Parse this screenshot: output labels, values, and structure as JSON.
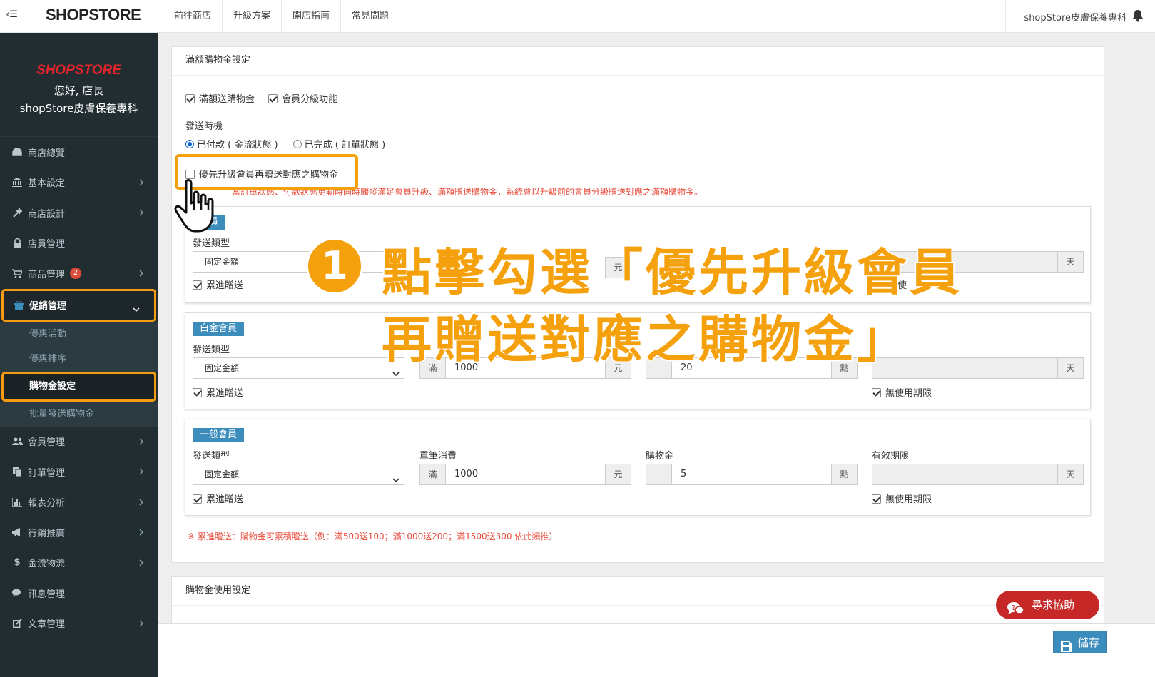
{
  "topbar": {
    "logo": "SHOPSTORE",
    "nav": [
      "前往商店",
      "升級方案",
      "開店指南",
      "常見問題"
    ],
    "shop_name": "shopStore皮膚保養專科"
  },
  "sidebar": {
    "logo": "SHOPSTORE",
    "greeting": "您好, 店長",
    "shop_name": "shopStore皮膚保養專科",
    "items": [
      {
        "label": "商店總覽",
        "icon": "dashboard-icon"
      },
      {
        "label": "基本設定",
        "icon": "bank-icon"
      },
      {
        "label": "商店設計",
        "icon": "magic-wand-icon"
      },
      {
        "label": "店員管理",
        "icon": "lock-icon"
      },
      {
        "label": "商品管理",
        "icon": "cart-icon",
        "badge": "2"
      },
      {
        "label": "促銷管理",
        "icon": "gift-icon"
      },
      {
        "label": "會員管理",
        "icon": "users-icon"
      },
      {
        "label": "訂單管理",
        "icon": "copy-icon"
      },
      {
        "label": "報表分析",
        "icon": "bar-chart-icon"
      },
      {
        "label": "行銷推廣",
        "icon": "bullhorn-icon"
      },
      {
        "label": "金流物流",
        "icon": "dollar-icon"
      },
      {
        "label": "訊息管理",
        "icon": "comments-icon"
      },
      {
        "label": "文章管理",
        "icon": "edit-icon"
      }
    ],
    "sub_items": [
      "優惠活動",
      "優惠排序",
      "購物金設定",
      "批量發送購物金"
    ]
  },
  "panel1": {
    "title": "滿額購物金設定",
    "check_full": "滿額送購物金",
    "check_level": "會員分級功能",
    "send_timing_label": "發送時機",
    "radio_paid": "已付款 ( 金流狀態 )",
    "radio_done": "已完成 ( 訂單狀態 )",
    "priority_check": "優先升級會員再贈送對應之購物金",
    "warning": "當訂單狀態、付款狀態更動時同時觸發滿足會員升級、滿額贈送購物金，系統會以升級前的會員分級贈送對應之滿額購物金。",
    "tiers": [
      {
        "name": "會員",
        "type": "固定金額",
        "unit_yuan": "元",
        "unit_day": "天",
        "accumulate": "累進贈送",
        "partial_expiry": "使"
      },
      {
        "name": "白金會員",
        "type": "固定金額",
        "prefix": "滿",
        "amount": "1000",
        "unit_yuan": "元",
        "points": "20",
        "unit_pt": "點",
        "unit_day": "天",
        "accumulate": "累進贈送",
        "no_expiry": "無使用期限"
      },
      {
        "name": "一般會員",
        "type": "固定金額",
        "prefix": "滿",
        "amount": "1000",
        "unit_yuan": "元",
        "points": "5",
        "unit_pt": "點",
        "unit_day": "天",
        "accumulate": "累進贈送",
        "no_expiry": "無使用期限"
      }
    ],
    "col_labels": {
      "type": "發送類型",
      "single": "單筆消費",
      "points": "購物金",
      "expiry": "有效期限"
    },
    "footnote": "※ 累進贈送：購物金可累積贈送（例：滿500送100；滿1000送200；滿1500送300 依此類推）"
  },
  "panel2": {
    "title": "購物金使用設定"
  },
  "annotation": {
    "step": "1",
    "line1": "點擊勾選「優先升級會員",
    "line2": "再贈送對應之購物金」"
  },
  "help_button": "尋求協助",
  "save_button": "儲存",
  "colors": {
    "accent": "#f5a10e",
    "sidebar": "#222d32",
    "primary": "#3c8dbc",
    "danger": "#e74c3c"
  }
}
